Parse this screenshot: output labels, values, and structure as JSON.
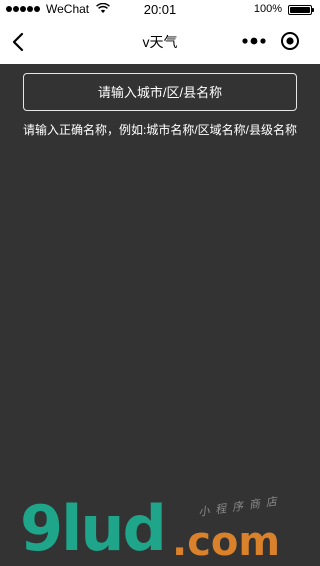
{
  "status_bar": {
    "carrier": "WeChat",
    "time": "20:01",
    "battery": "100%"
  },
  "nav": {
    "title": "v天气"
  },
  "search": {
    "placeholder": "请输入城市/区/县名称",
    "value": ""
  },
  "hint": "请输入正确名称，例如:城市名称/区域名称/县级名称",
  "watermark": {
    "logo": "9lud",
    "domain": ".com",
    "tagline": "小程序商店"
  },
  "colors": {
    "background": "#333333",
    "nav_background": "#ffffff",
    "watermark_green": "#1fa58a",
    "watermark_orange": "#d9822b"
  },
  "icons": [
    "signal-icon",
    "wifi-icon",
    "battery-icon",
    "back-arrow-icon",
    "more-dots-icon",
    "close-circle-icon"
  ]
}
